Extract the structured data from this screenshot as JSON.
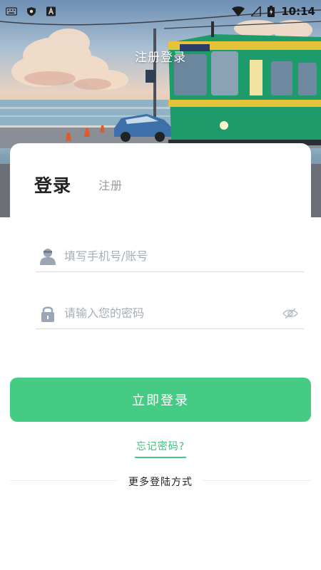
{
  "status_bar": {
    "time": "10:14",
    "icons": [
      "keyboard-icon",
      "shield-icon",
      "a-badge-icon",
      "wifi-icon",
      "signal-icon",
      "battery-icon"
    ]
  },
  "header": {
    "title": "注册登录"
  },
  "tabs": [
    {
      "label": "登录",
      "active": true
    },
    {
      "label": "注册",
      "active": false
    }
  ],
  "form": {
    "account_placeholder": "填写手机号/账号",
    "account_value": "",
    "password_placeholder": "请输入您的密码",
    "password_value": ""
  },
  "actions": {
    "login_label": "立即登录",
    "forgot_label": "忘记密码?",
    "more_methods_label": "更多登陆方式"
  },
  "colors": {
    "accent": "#45cb84",
    "link": "#3fbf7c",
    "train_green": "#1e9b6a",
    "train_yellow": "#e7c33a"
  }
}
